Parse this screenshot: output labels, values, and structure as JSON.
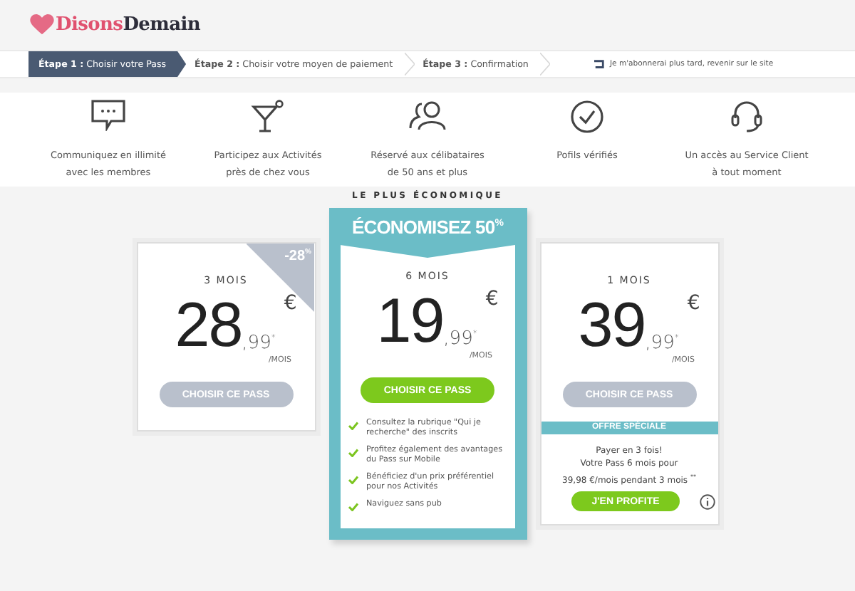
{
  "logo": {
    "part_1": "Disons",
    "part_2": "Demain"
  },
  "steps": [
    {
      "number": "Étape 1 :",
      "label": "Choisir votre Pass",
      "selected": true
    },
    {
      "number": "Étape 2 :",
      "label": "Choisir votre moyen de paiement",
      "selected": false
    },
    {
      "number": "Étape 3 :",
      "label": "Confirmation",
      "selected": false
    }
  ],
  "later_link": "Je m'abonnerai plus tard, revenir sur le site",
  "features": [
    {
      "kind": "chat",
      "text": "Communiquez en illimité\navec les membres"
    },
    {
      "kind": "cocktail",
      "text": "Participez aux Activités\nprès de chez vous"
    },
    {
      "kind": "people",
      "text": "Réservé aux célibataires\nde 50 ans et plus"
    },
    {
      "kind": "check",
      "text": "Pofils vérifiés"
    },
    {
      "kind": "headset",
      "text": "Un accès au Service Client\nà tout moment"
    }
  ],
  "plans": [
    {
      "highlighted": false,
      "badge": "-28$^{%}$",
      "duration": "3 MOIS",
      "price": "28",
      "cents": ",99$^{*}$",
      "currency": "€",
      "per": "/MOIS",
      "button": "CHOISIR CE PASS"
    },
    {
      "highlighted": true,
      "ribbon": "LE PLUS ÉCONOMIQUE",
      "header": "ÉCONOMISEZ 50$^{%}$",
      "duration": "6 MOIS",
      "price": "19",
      "cents": ",99$^{*}$",
      "currency": "€",
      "per": "/MOIS",
      "button": "CHOISIR CE PASS",
      "benefits": [
        "Consultez la rubrique \"Qui je recherche\" des inscrits",
        "Profitez également des avantages du Pass sur Mobile",
        "Bénéficiez d'un prix préférentiel pour nos Activités",
        "Naviguez sans pub"
      ]
    },
    {
      "highlighted": false,
      "duration": "1 MOIS",
      "price": "39",
      "cents": ",99$^{*}$",
      "currency": "€",
      "per": "/MOIS",
      "button": "CHOISIR CE PASS",
      "offer": {
        "title": "OFFRE SPÉCIALE",
        "text": "Payer en 3 fois!\nVotre Pass 6 mois pour\n39,98 €/mois pendant 3 mois $^{**}$",
        "button": "J'EN PROFITE"
      }
    }
  ]
}
